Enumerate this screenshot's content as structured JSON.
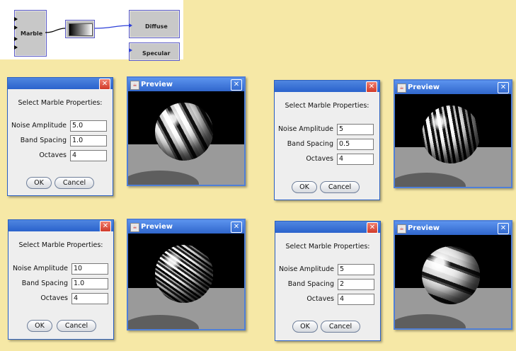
{
  "node_graph": {
    "source_node": "Marble",
    "targets": [
      "Diffuse",
      "Specular"
    ]
  },
  "dialogs": [
    {
      "heading": "Select Marble Properties:",
      "labels": {
        "noise": "Noise Amplitude",
        "band": "Band Spacing",
        "octaves": "Octaves"
      },
      "values": {
        "noise": "5.0",
        "band": "1.0",
        "octaves": "4"
      },
      "ok": "OK",
      "cancel": "Cancel",
      "close": "✕"
    },
    {
      "heading": "Select Marble Properties:",
      "labels": {
        "noise": "Noise Amplitude",
        "band": "Band Spacing",
        "octaves": "Octaves"
      },
      "values": {
        "noise": "5",
        "band": "0.5",
        "octaves": "4"
      },
      "ok": "OK",
      "cancel": "Cancel",
      "close": "✕"
    },
    {
      "heading": "Select Marble Properties:",
      "labels": {
        "noise": "Noise Amplitude",
        "band": "Band Spacing",
        "octaves": "Octaves"
      },
      "values": {
        "noise": "10",
        "band": "1.0",
        "octaves": "4"
      },
      "ok": "OK",
      "cancel": "Cancel",
      "close": "✕"
    },
    {
      "heading": "Select Marble Properties:",
      "labels": {
        "noise": "Noise Amplitude",
        "band": "Band Spacing",
        "octaves": "Octaves"
      },
      "values": {
        "noise": "5",
        "band": "2",
        "octaves": "4"
      },
      "ok": "OK",
      "cancel": "Cancel",
      "close": "✕"
    }
  ],
  "previews": [
    {
      "title": "Preview",
      "close": "✕"
    },
    {
      "title": "Preview",
      "close": "✕"
    },
    {
      "title": "Preview",
      "close": "✕"
    },
    {
      "title": "Preview",
      "close": "✕"
    }
  ],
  "colors": {
    "background": "#f6e8a6",
    "titlebar": "#2a62cc",
    "close_red": "#d03a2a",
    "wire_blue": "#2d3fd8"
  }
}
